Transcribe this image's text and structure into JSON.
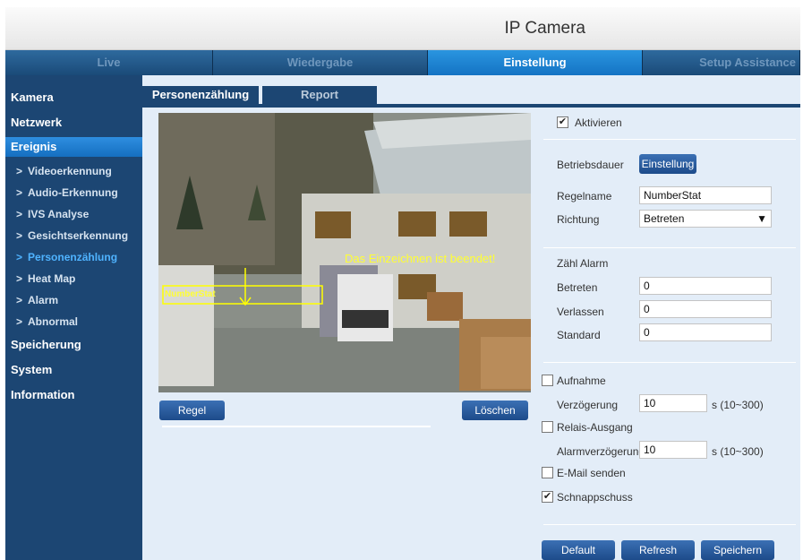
{
  "app": {
    "title": "IP Camera"
  },
  "nav": {
    "tabs": [
      {
        "label": "Live"
      },
      {
        "label": "Wiedergabe"
      },
      {
        "label": "Einstellung"
      },
      {
        "label": "Setup Assistance"
      }
    ]
  },
  "sidebar": {
    "kamera": "Kamera",
    "netzwerk": "Netzwerk",
    "ereignis": "Ereignis",
    "items": [
      {
        "label": "Videoerkennung"
      },
      {
        "label": "Audio-Erkennung"
      },
      {
        "label": "IVS Analyse"
      },
      {
        "label": "Gesichtserkennung"
      },
      {
        "label": "Personenzählung"
      },
      {
        "label": "Heat Map"
      },
      {
        "label": "Alarm"
      },
      {
        "label": "Abnormal"
      }
    ],
    "speicherung": "Speicherung",
    "system": "System",
    "information": "Information"
  },
  "tabs": {
    "people": "Personenzählung",
    "report": "Report"
  },
  "video": {
    "overlay_message": "Das Einzeichnen ist beendet!",
    "rule_label": "NumberStat"
  },
  "buttons": {
    "regel": "Regel",
    "loeschen": "Löschen",
    "einstellung": "Einstellung",
    "default": "Default",
    "refresh": "Refresh",
    "speichern": "Speichern"
  },
  "settings": {
    "aktivieren": "Aktivieren",
    "aktivieren_checked": true,
    "betriebsdauer": "Betriebsdauer",
    "regelname_label": "Regelname",
    "regelname_value": "NumberStat",
    "richtung_label": "Richtung",
    "richtung_value": "Betreten",
    "zaehl_alarm": "Zähl Alarm",
    "betreten_label": "Betreten",
    "betreten_value": "0",
    "verlassen_label": "Verlassen",
    "verlassen_value": "0",
    "standard_label": "Standard",
    "standard_value": "0",
    "aufnahme": "Aufnahme",
    "aufnahme_checked": false,
    "verzoegerung_label": "Verzögerung",
    "verzoegerung_value": "10",
    "verzoegerung_range": "s (10~300)",
    "relais": "Relais-Ausgang",
    "relais_checked": false,
    "alarmverz_label": "Alarmverzögerung",
    "alarmverz_value": "10",
    "alarmverz_range": "s (10~300)",
    "email": "E-Mail senden",
    "email_checked": false,
    "schnapp": "Schnappschuss",
    "schnapp_checked": true
  }
}
